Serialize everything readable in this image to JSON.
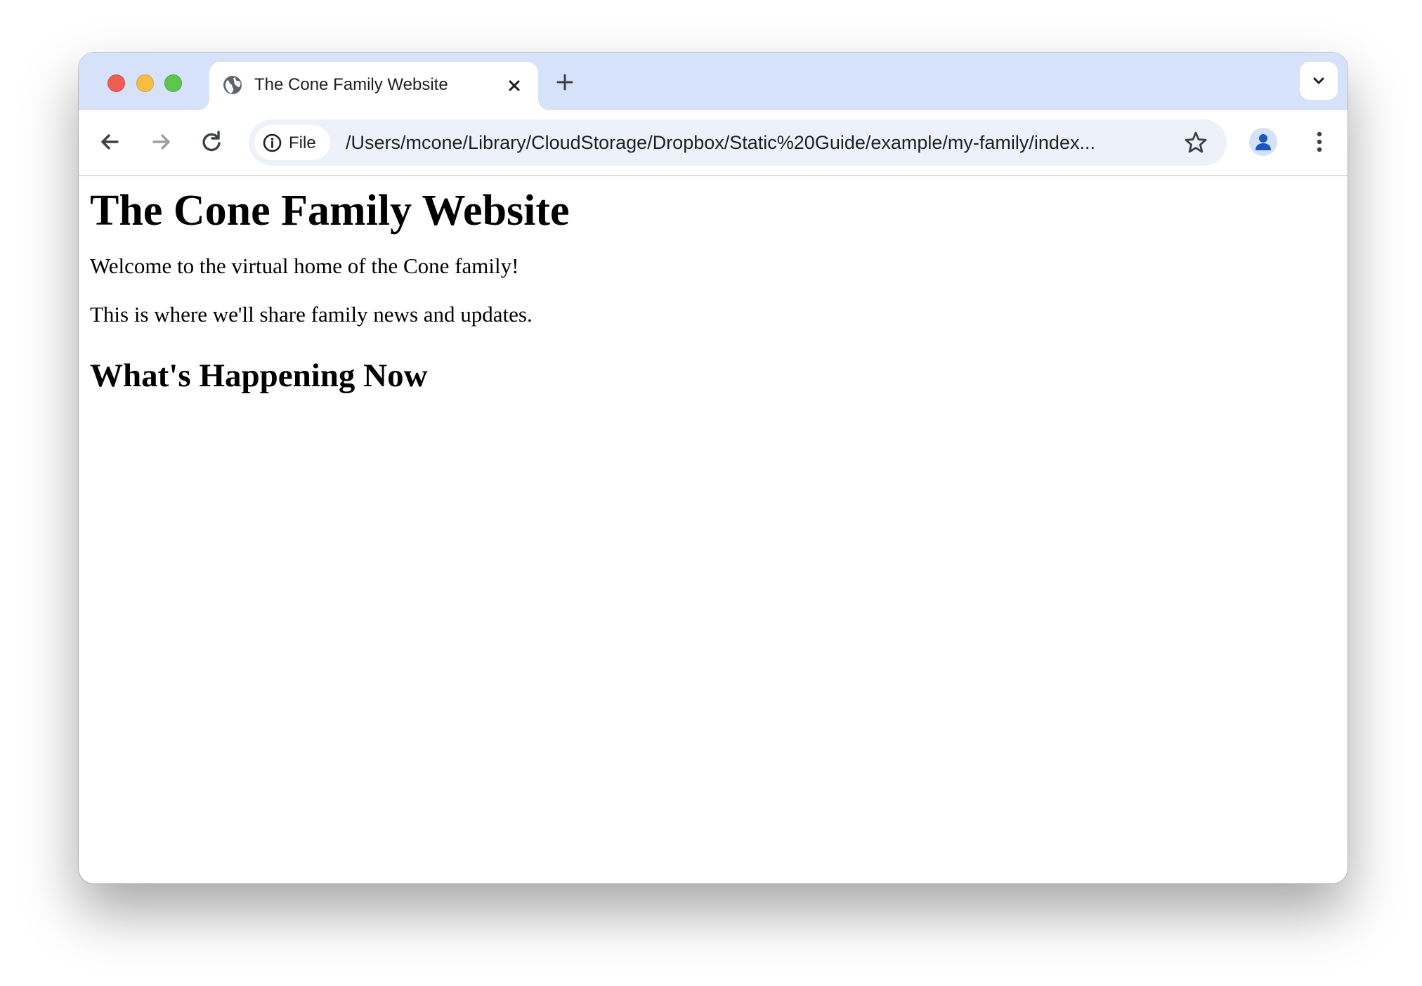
{
  "window_controls": {
    "close": "close-window",
    "minimize": "minimize-window",
    "maximize": "maximize-window"
  },
  "tab": {
    "title": "The Cone Family Website",
    "favicon_icon": "globe-icon",
    "close_icon": "close-icon"
  },
  "tabstrip": {
    "new_tab_icon": "plus-icon",
    "tab_search_icon": "chevron-down-icon"
  },
  "toolbar": {
    "back_icon": "arrow-left-icon",
    "forward_icon": "arrow-right-icon",
    "reload_icon": "reload-icon",
    "site_info_icon": "info-icon",
    "site_chip_label": "File",
    "url": "/Users/mcone/Library/CloudStorage/Dropbox/Static%20Guide/example/my-family/index...",
    "bookmark_icon": "star-icon",
    "profile_icon": "person-icon",
    "menu_icon": "kebab-menu-icon"
  },
  "page": {
    "heading": "The Cone Family Website",
    "paragraphs": [
      "Welcome to the virtual home of the Cone family!",
      "This is where we'll share family news and updates."
    ],
    "subheading": "What's Happening Now"
  },
  "colors": {
    "tabstrip_bg": "#d6e2fa",
    "omnibox_bg": "#edf1fa",
    "close": "#ee5e55",
    "minimize": "#f5bd41",
    "maximize": "#5fc64c",
    "profile_accent": "#1a56c4"
  }
}
